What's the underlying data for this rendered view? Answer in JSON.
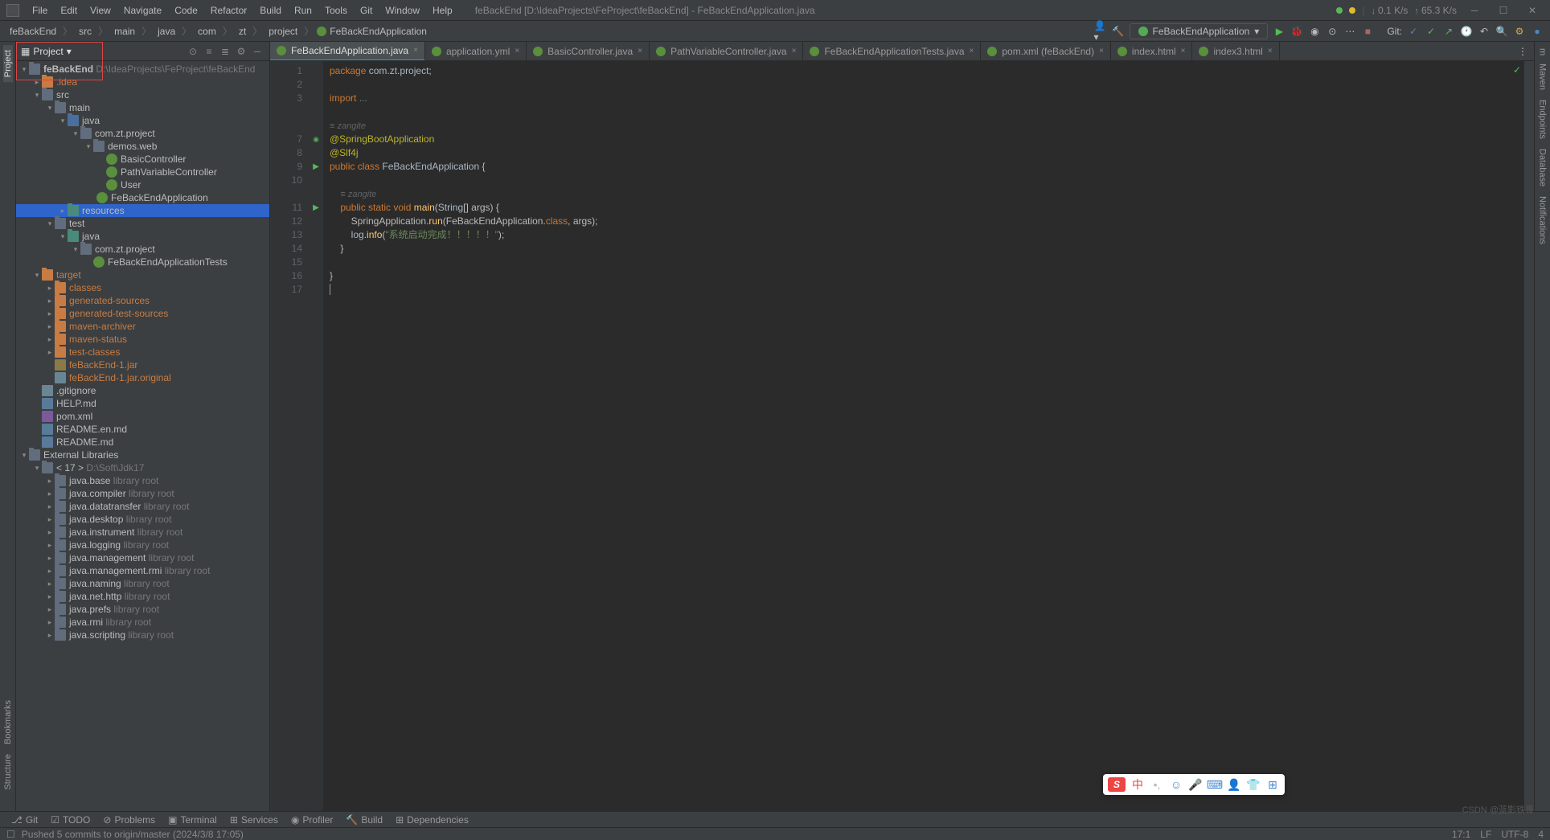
{
  "title": "feBackEnd [D:\\IdeaProjects\\FeProject\\feBackEnd] - FeBackEndApplication.java",
  "menu": [
    "File",
    "Edit",
    "View",
    "Navigate",
    "Code",
    "Refactor",
    "Build",
    "Run",
    "Tools",
    "Git",
    "Window",
    "Help"
  ],
  "stats": {
    "down": "0.1 K/s",
    "up": "65.3 K/s"
  },
  "breadcrumbs": [
    "feBackEnd",
    "src",
    "main",
    "java",
    "com",
    "zt",
    "project",
    "FeBackEndApplication"
  ],
  "run_config": "FeBackEndApplication",
  "git_label": "Git:",
  "panel": {
    "title": "Project"
  },
  "tree": {
    "root": {
      "name": "feBackEnd",
      "path": "D:\\IdeaProjects\\FeProject\\feBackEnd"
    },
    "idea": ".idea",
    "src": "src",
    "main": "main",
    "java": "java",
    "pkg": "com.zt.project",
    "demos": "demos.web",
    "c1": "BasicController",
    "c2": "PathVariableController",
    "c3": "User",
    "c4": "FeBackEndApplication",
    "resources": "resources",
    "test": "test",
    "java2": "java",
    "pkg2": "com.zt.project",
    "tests": "FeBackEndApplicationTests",
    "target": "target",
    "classes": "classes",
    "gensrc": "generated-sources",
    "gentest": "generated-test-sources",
    "marchiver": "maven-archiver",
    "mstatus": "maven-status",
    "testclasses": "test-classes",
    "jar1": "feBackEnd-1.jar",
    "jar2": "feBackEnd-1.jar.original",
    "gitignore": ".gitignore",
    "help": "HELP.md",
    "pom": "pom.xml",
    "readme1": "README.en.md",
    "readme2": "README.md",
    "extlib": "External Libraries",
    "jdk": "< 17 >",
    "jdkpath": "D:\\Soft\\Jdk17",
    "libs": [
      "java.base",
      "java.compiler",
      "java.datatransfer",
      "java.desktop",
      "java.instrument",
      "java.logging",
      "java.management",
      "java.management.rmi",
      "java.naming",
      "java.net.http",
      "java.prefs",
      "java.rmi",
      "java.scripting"
    ],
    "libroot": "library root"
  },
  "tabs": [
    {
      "name": "FeBackEndApplication.java",
      "icon": "class",
      "active": true
    },
    {
      "name": "application.yml",
      "icon": "yml"
    },
    {
      "name": "BasicController.java",
      "icon": "class"
    },
    {
      "name": "PathVariableController.java",
      "icon": "class"
    },
    {
      "name": "FeBackEndApplicationTests.java",
      "icon": "class"
    },
    {
      "name": "pom.xml (feBackEnd)",
      "icon": "maven"
    },
    {
      "name": "index.html",
      "icon": "html"
    },
    {
      "name": "index3.html",
      "icon": "html"
    }
  ],
  "code": {
    "author": "zangite",
    "lines": [
      {
        "n": 1,
        "html": "<span class='kw'>package</span> <span class='id'>com.zt.project</span>;"
      },
      {
        "n": 2,
        "html": ""
      },
      {
        "n": 3,
        "html": "<span class='kw'>import</span> <span class='com'>...</span>"
      },
      {
        "n": "",
        "html": ""
      },
      {
        "n": "",
        "html": "<span class='author'>≡ zangite</span>"
      },
      {
        "n": 7,
        "html": "<span class='ann'>@SpringBootApplication</span>",
        "mark": "impl"
      },
      {
        "n": 8,
        "html": "<span class='ann'>@Slf4j</span>"
      },
      {
        "n": 9,
        "html": "<span class='kw'>public</span> <span class='kw'>class</span> <span class='type'>FeBackEndApplication</span> {",
        "mark": "run"
      },
      {
        "n": 10,
        "html": ""
      },
      {
        "n": "",
        "html": "    <span class='author'>≡ zangite</span>"
      },
      {
        "n": 11,
        "html": "    <span class='kw'>public</span> <span class='kw'>static</span> <span class='kw'>void</span> <span class='method'>main</span>(<span class='type'>String</span>[] args) {",
        "mark": "run"
      },
      {
        "n": 12,
        "html": "        SpringApplication.<span class='method'>run</span>(FeBackEndApplication.<span class='kw'>class</span>, args);"
      },
      {
        "n": 13,
        "html": "        <span class='id'>log</span>.<span class='method'>info</span>(<span class='str'>\"系统启动完成！！！！！\"</span>);"
      },
      {
        "n": 14,
        "html": "    }"
      },
      {
        "n": 15,
        "html": ""
      },
      {
        "n": 16,
        "html": "}"
      },
      {
        "n": 17,
        "html": "<span style='border-left:1px solid #999'>&nbsp;</span>"
      }
    ]
  },
  "left_tools": [
    "Project",
    "Bookmarks",
    "Structure"
  ],
  "right_tools": [
    "Maven",
    "Endpoints",
    "Database",
    "Notifications"
  ],
  "bottom_tools": [
    "Git",
    "TODO",
    "Problems",
    "Terminal",
    "Services",
    "Profiler",
    "Build",
    "Dependencies"
  ],
  "status": {
    "msg": "Pushed 5 commits to origin/master (2024/3/8 17:05)",
    "pos": "17:1",
    "lf": "LF",
    "enc": "UTF-8",
    "spaces": "4"
  },
  "watermark": "CSDN @蓝影铁哥"
}
